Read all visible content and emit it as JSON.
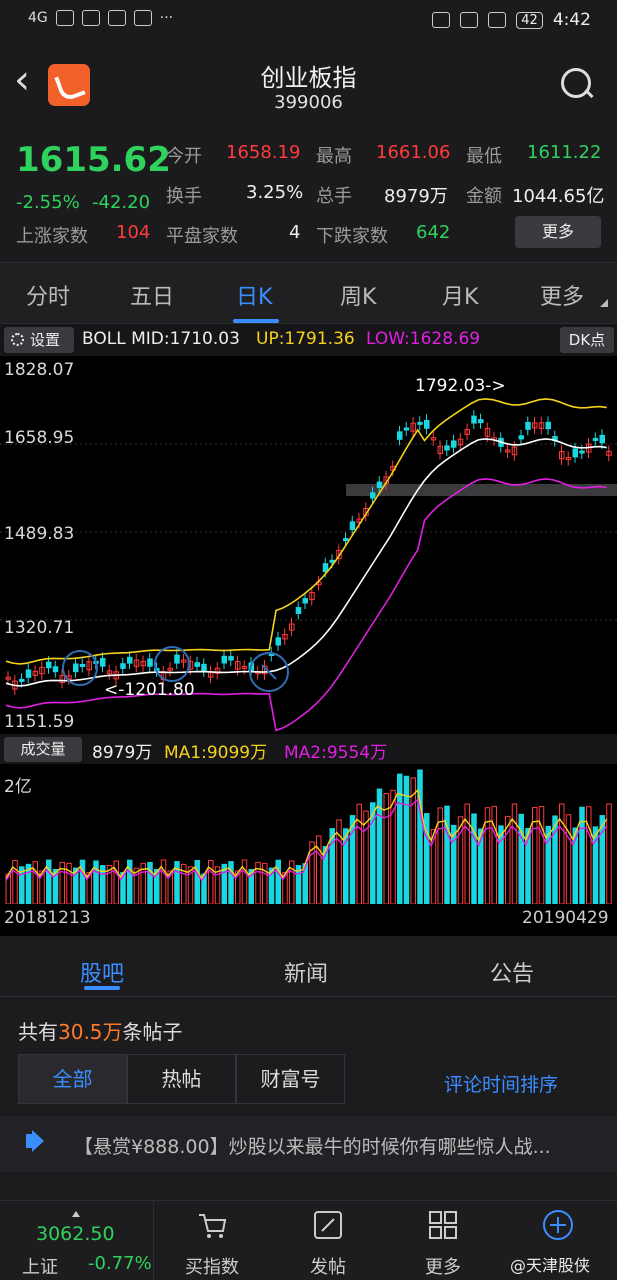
{
  "status_bar": {
    "signal": "4G",
    "battery": "42",
    "time": "4:42"
  },
  "header": {
    "title": "创业板指",
    "code": "399006"
  },
  "quote": {
    "price": "1615.62",
    "change_pct": "-2.55%",
    "change": "-42.20",
    "open_label": "今开",
    "open": "1658.19",
    "high_label": "最高",
    "high": "1661.06",
    "low_label": "最低",
    "low": "1611.22",
    "turnover_label": "换手",
    "turnover": "3.25%",
    "volume_label": "总手",
    "volume": "8979万",
    "amount_label": "金额",
    "amount": "1044.65亿",
    "rise_label": "上涨家数",
    "rise": "104",
    "flat_label": "平盘家数",
    "flat": "4",
    "fall_label": "下跌家数",
    "fall": "642",
    "more": "更多"
  },
  "tabs": [
    "分时",
    "五日",
    "日K",
    "周K",
    "月K",
    "更多"
  ],
  "indicator": {
    "settings": "设置",
    "boll": "BOLL MID:1710.03",
    "up": "UP:1791.36",
    "low": "LOW:1628.69",
    "dk": "DK点"
  },
  "price_axis": [
    "1828.07",
    "1658.95",
    "1489.83",
    "1320.71",
    "1151.59"
  ],
  "annotations": {
    "high": "1792.03->",
    "low": "<-1201.80"
  },
  "volume_bar": {
    "label": "成交量",
    "vol": "8979万",
    "ma1": "MA1:9099万",
    "ma2": "MA2:9554万"
  },
  "volume_axis": "2亿",
  "dates": {
    "start": "20181213",
    "end": "20190429"
  },
  "section_tabs": [
    "股吧",
    "新闻",
    "公告"
  ],
  "posts": {
    "prefix": "共有",
    "count": "30.5万",
    "suffix": "条帖子"
  },
  "filters": [
    "全部",
    "热帖",
    "财富号"
  ],
  "sort": "评论时间排序",
  "notice": "【悬赏¥888.00】炒股以来最牛的时候你有哪些惊人战...",
  "bottom": {
    "index_value": "3062.50",
    "index_name": "上证",
    "index_pct": "-0.77%",
    "nav": [
      "买指数",
      "发帖",
      "更多"
    ]
  },
  "watermark": "@天津股侠",
  "colors": {
    "up": "#ff3b3b",
    "down": "#2fd25c",
    "accent": "#3a8eff",
    "candle_down": "#1ad6e0",
    "boll_up": "#f5d31c",
    "boll_low": "#e020e0",
    "boll_mid": "#ffffff"
  }
}
